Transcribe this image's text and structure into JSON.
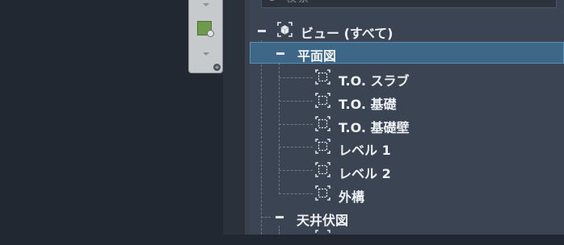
{
  "search": {
    "text": "検索"
  },
  "tree": {
    "root": {
      "label": "ビュー (すべて)"
    },
    "groups": [
      {
        "label": "平面図",
        "selected": true,
        "items": [
          {
            "label": "T.O. スラブ"
          },
          {
            "label": "T.O. 基礎"
          },
          {
            "label": "T.O. 基礎壁"
          },
          {
            "label": "レベル 1"
          },
          {
            "label": "レベル 2"
          },
          {
            "label": "外構"
          }
        ]
      },
      {
        "label": "天井伏図",
        "selected": false,
        "items": []
      }
    ]
  },
  "colors": {
    "panel_bg": "#3b4453",
    "selected_bg": "#3d6687",
    "canvas_bg": "#222831",
    "toolstrip_bg": "#c6cacc"
  },
  "icons": {
    "view_item": "dashed-frame-icon",
    "root": "cube-view-icon",
    "collapse": "minus-icon"
  }
}
